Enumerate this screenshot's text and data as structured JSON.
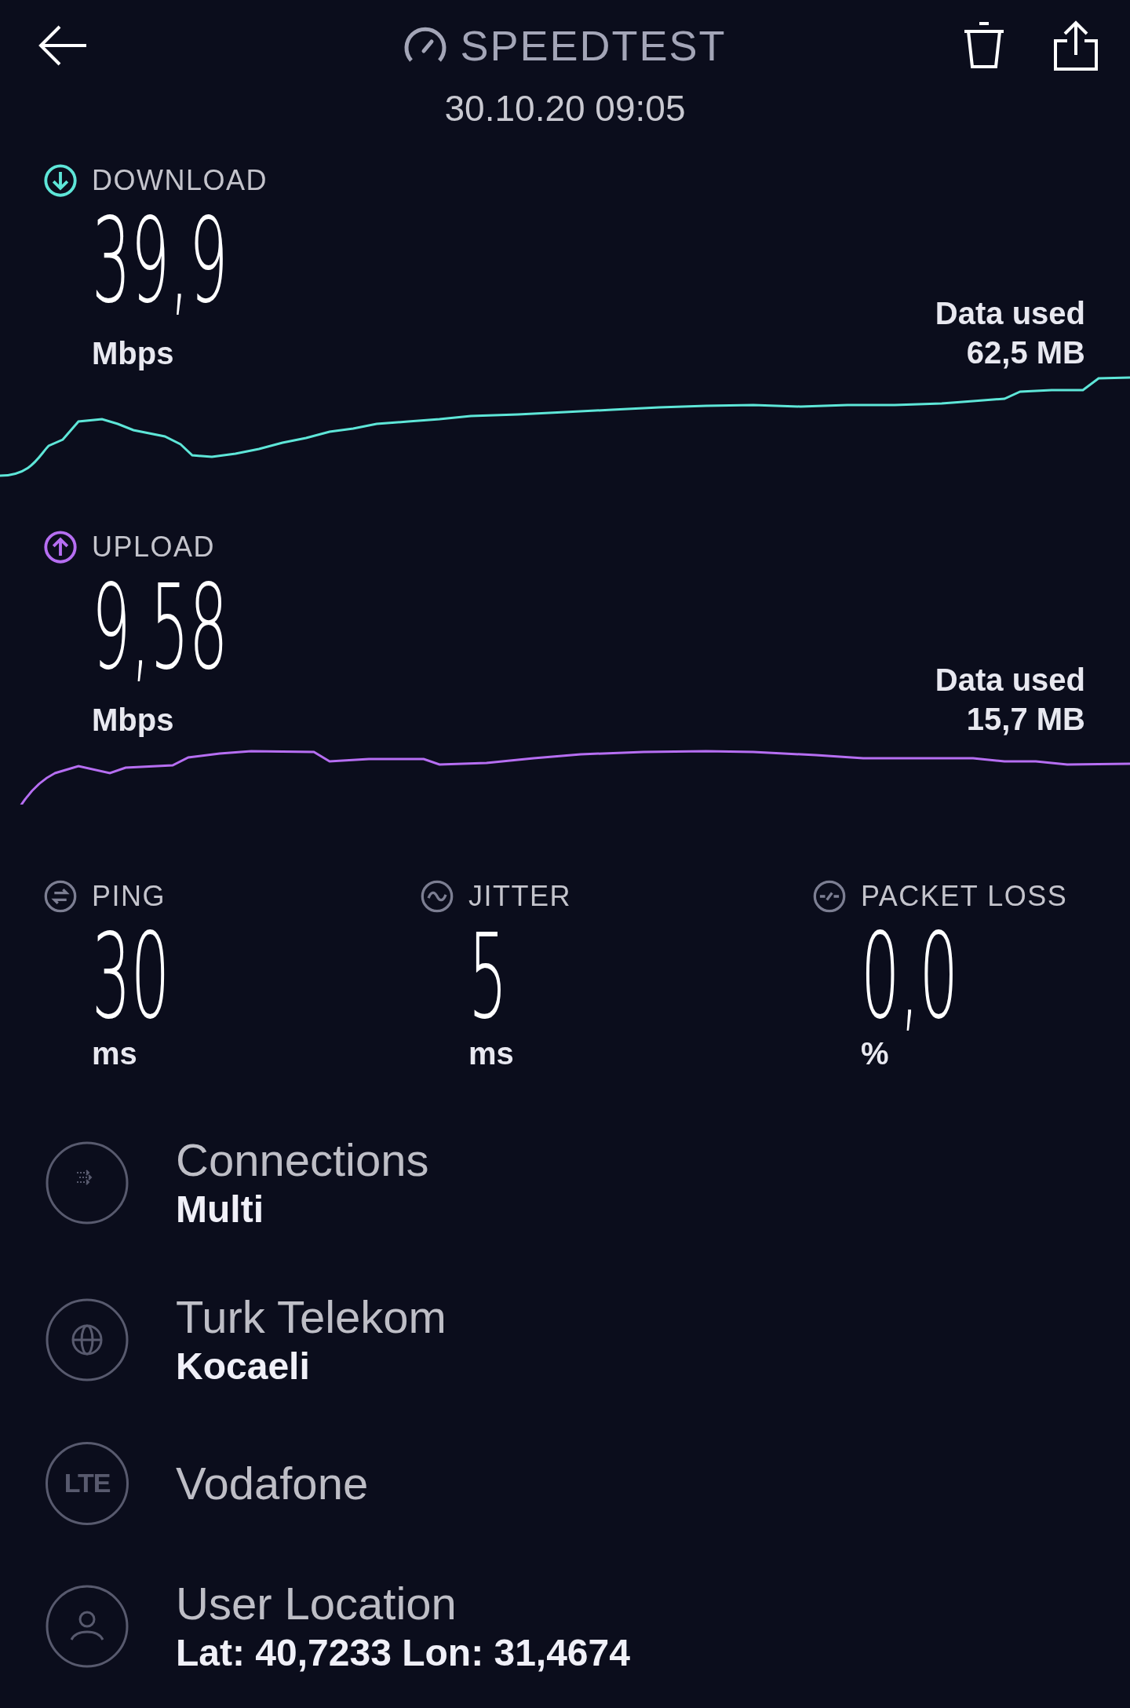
{
  "header": {
    "title": "SPEEDTEST",
    "date": "30.10.20 09:05"
  },
  "tests": [
    {
      "kind": "download",
      "label": "DOWNLOAD",
      "value": "39,9",
      "unit": "Mbps",
      "data_label": "Data used",
      "data_value": "62,5 MB",
      "color": "#5ee6d8"
    },
    {
      "kind": "upload",
      "label": "UPLOAD",
      "value": "9,58",
      "unit": "Mbps",
      "data_label": "Data used",
      "data_value": "15,7 MB",
      "color": "#b66ef2"
    }
  ],
  "metrics": [
    {
      "kind": "ping",
      "label": "PING",
      "value": "30",
      "unit": "ms"
    },
    {
      "kind": "jitter",
      "label": "JITTER",
      "value": "5",
      "unit": "ms"
    },
    {
      "kind": "packet_loss",
      "label": "PACKET LOSS",
      "value": "0,0",
      "unit": "%"
    }
  ],
  "details": [
    {
      "kind": "connections",
      "title": "Connections",
      "value": "Multi"
    },
    {
      "kind": "server",
      "title": "Turk Telekom",
      "value": "Kocaeli"
    },
    {
      "kind": "network",
      "badge": "LTE",
      "title": "Vodafone"
    },
    {
      "kind": "location",
      "title": "User Location",
      "value": "Lat: 40,7233 Lon: 31,4674"
    }
  ]
}
